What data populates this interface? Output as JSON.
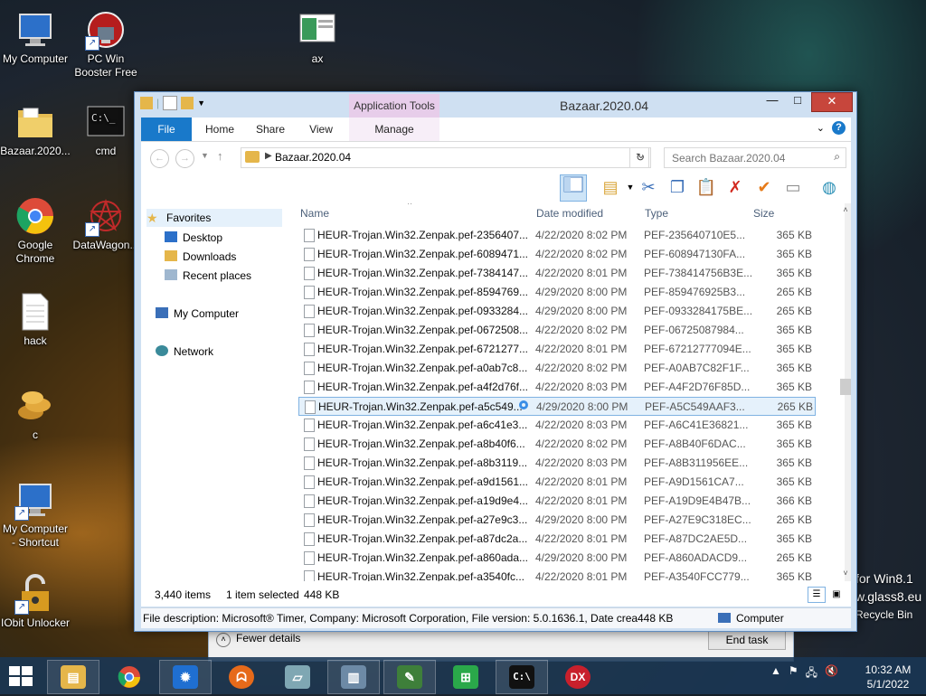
{
  "desktop": {
    "icons": [
      {
        "label": "My Computer"
      },
      {
        "label": "PC Win Booster Free"
      },
      {
        "label": "ax"
      },
      {
        "label": "Bazaar.2020..."
      },
      {
        "label": "cmd"
      },
      {
        "label": "Google Chrome"
      },
      {
        "label": "DataWagon..."
      },
      {
        "label": "hack"
      },
      {
        "label": "c"
      },
      {
        "label": "My Computer - Shortcut"
      },
      {
        "label": "IObit Unlocker"
      }
    ],
    "watermark": {
      "line1": "for Win8.1",
      "line2": "w.glass8.eu",
      "recycle": "Recycle Bin"
    }
  },
  "window": {
    "title": "Bazaar.2020.04",
    "context_tab_header": "Application Tools",
    "controls": {
      "minimize": "—",
      "maximize": "□",
      "close": "✕"
    },
    "ribbon_tabs": [
      {
        "label": "File"
      },
      {
        "label": "Home"
      },
      {
        "label": "Share"
      },
      {
        "label": "View"
      },
      {
        "label": "Manage"
      }
    ],
    "address": {
      "path": "Bazaar.2020.04",
      "search_placeholder": "Search Bazaar.2020.04"
    },
    "nav": {
      "favorites": "Favorites",
      "desktop": "Desktop",
      "downloads": "Downloads",
      "recent": "Recent places",
      "computer": "My Computer",
      "network": "Network"
    },
    "columns": {
      "name": "Name",
      "date": "Date modified",
      "type": "Type",
      "size": "Size"
    },
    "files": [
      {
        "name": "HEUR-Trojan.Win32.Zenpak.pef-2356407...",
        "date": "4/22/2020 8:02 PM",
        "type": "PEF-235640710E5...",
        "size": "365 KB"
      },
      {
        "name": "HEUR-Trojan.Win32.Zenpak.pef-6089471...",
        "date": "4/22/2020 8:02 PM",
        "type": "PEF-608947130FA...",
        "size": "365 KB"
      },
      {
        "name": "HEUR-Trojan.Win32.Zenpak.pef-7384147...",
        "date": "4/22/2020 8:01 PM",
        "type": "PEF-738414756B3E...",
        "size": "365 KB"
      },
      {
        "name": "HEUR-Trojan.Win32.Zenpak.pef-8594769...",
        "date": "4/29/2020 8:00 PM",
        "type": "PEF-859476925B3...",
        "size": "265 KB"
      },
      {
        "name": "HEUR-Trojan.Win32.Zenpak.pef-0933284...",
        "date": "4/29/2020 8:00 PM",
        "type": "PEF-0933284175BE...",
        "size": "265 KB"
      },
      {
        "name": "HEUR-Trojan.Win32.Zenpak.pef-0672508...",
        "date": "4/22/2020 8:02 PM",
        "type": "PEF-06725087984...",
        "size": "365 KB"
      },
      {
        "name": "HEUR-Trojan.Win32.Zenpak.pef-6721277...",
        "date": "4/22/2020 8:01 PM",
        "type": "PEF-67212777094E...",
        "size": "365 KB"
      },
      {
        "name": "HEUR-Trojan.Win32.Zenpak.pef-a0ab7c8...",
        "date": "4/22/2020 8:02 PM",
        "type": "PEF-A0AB7C82F1F...",
        "size": "365 KB"
      },
      {
        "name": "HEUR-Trojan.Win32.Zenpak.pef-a4f2d76f...",
        "date": "4/22/2020 8:03 PM",
        "type": "PEF-A4F2D76F85D...",
        "size": "365 KB"
      },
      {
        "name": "HEUR-Trojan.Win32.Zenpak.pef-a5c549...",
        "date": "4/29/2020 8:00 PM",
        "type": "PEF-A5C549AAF3...",
        "size": "265 KB",
        "selected": true
      },
      {
        "name": "HEUR-Trojan.Win32.Zenpak.pef-a6c41e3...",
        "date": "4/22/2020 8:03 PM",
        "type": "PEF-A6C41E36821...",
        "size": "365 KB"
      },
      {
        "name": "HEUR-Trojan.Win32.Zenpak.pef-a8b40f6...",
        "date": "4/22/2020 8:02 PM",
        "type": "PEF-A8B40F6DAC...",
        "size": "365 KB"
      },
      {
        "name": "HEUR-Trojan.Win32.Zenpak.pef-a8b3119...",
        "date": "4/22/2020 8:03 PM",
        "type": "PEF-A8B311956EE...",
        "size": "365 KB"
      },
      {
        "name": "HEUR-Trojan.Win32.Zenpak.pef-a9d1561...",
        "date": "4/22/2020 8:01 PM",
        "type": "PEF-A9D1561CA7...",
        "size": "365 KB"
      },
      {
        "name": "HEUR-Trojan.Win32.Zenpak.pef-a19d9e4...",
        "date": "4/22/2020 8:01 PM",
        "type": "PEF-A19D9E4B47B...",
        "size": "366 KB"
      },
      {
        "name": "HEUR-Trojan.Win32.Zenpak.pef-a27e9c3...",
        "date": "4/29/2020 8:00 PM",
        "type": "PEF-A27E9C318EC...",
        "size": "265 KB"
      },
      {
        "name": "HEUR-Trojan.Win32.Zenpak.pef-a87dc2a...",
        "date": "4/22/2020 8:01 PM",
        "type": "PEF-A87DC2AE5D...",
        "size": "365 KB"
      },
      {
        "name": "HEUR-Trojan.Win32.Zenpak.pef-a860ada...",
        "date": "4/29/2020 8:00 PM",
        "type": "PEF-A860ADACD9...",
        "size": "265 KB"
      },
      {
        "name": "HEUR-Trojan.Win32.Zenpak.pef-a3540fc...",
        "date": "4/22/2020 8:01 PM",
        "type": "PEF-A3540FCC779...",
        "size": "365 KB"
      }
    ],
    "status": {
      "count": "3,440 items",
      "selected": "1 item selected",
      "selected_size": "448 KB"
    },
    "details": {
      "description": "File description: Microsoft® Timer, Company: Microsoft Corporation, File version: 5.0.1636.1, Date crea",
      "size": "448 KB",
      "location": "Computer"
    }
  },
  "task_manager": {
    "fewer_details": "Fewer details",
    "end_task": "End task"
  },
  "taskbar": {
    "clock_time": "10:32 AM",
    "clock_date": "5/1/2022",
    "apps": [
      "file-explorer",
      "google-chrome",
      "settings",
      "firefox",
      "notepad",
      "system-monitor",
      "editor",
      "store",
      "cmd",
      "dx"
    ]
  }
}
